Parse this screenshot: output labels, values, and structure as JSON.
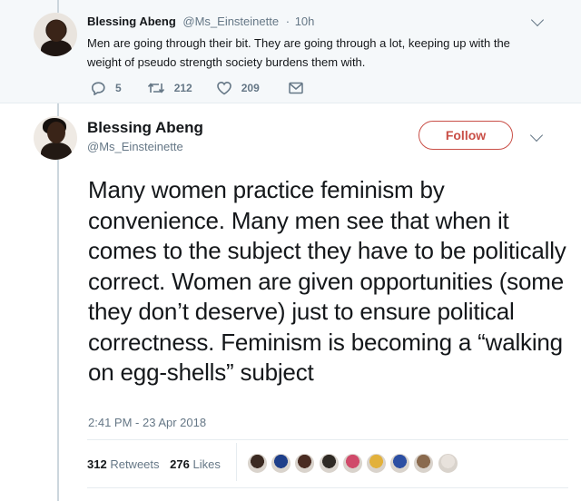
{
  "parent_tweet": {
    "name": "Blessing Abeng",
    "handle": "@Ms_Einsteinette",
    "separator": "·",
    "time": "10h",
    "text": "Men are going through their bit. They are going through a lot, keeping up with the weight of pseudo strength society burdens them with.",
    "replies": "5",
    "retweets": "212",
    "likes": "209"
  },
  "main_tweet": {
    "name": "Blessing Abeng",
    "handle": "@Ms_Einsteinette",
    "follow_label": "Follow",
    "text": "Many women practice feminism by convenience. Many men see that when it comes to the subject they have to be politically correct. Women are given opportunities (some they don’t deserve) just to ensure political correctness. Feminism is becoming a “walking on egg-shells” subject",
    "timestamp": "2:41 PM - 23 Apr 2018",
    "retweet_count": "312",
    "retweet_label": "Retweets",
    "like_count": "276",
    "like_label": "Likes"
  },
  "colors": {
    "accent": "#c94f47",
    "muted": "#657786",
    "text": "#14171a",
    "background_parent": "#f5f8fa"
  },
  "icons": {
    "reply": "reply-icon",
    "retweet": "retweet-icon",
    "like": "heart-icon",
    "dm": "envelope-icon",
    "more": "chevron-down-icon"
  },
  "likers": [
    {
      "color": "#3b2a22"
    },
    {
      "color": "#1e3f8a"
    },
    {
      "color": "#4a2c22"
    },
    {
      "color": "#2f2a25"
    },
    {
      "color": "#d04a6a"
    },
    {
      "color": "#e2b13c"
    },
    {
      "color": "#2c4fa3"
    },
    {
      "color": "#8a6a4e"
    },
    {
      "color": "#e8e2dc"
    }
  ]
}
